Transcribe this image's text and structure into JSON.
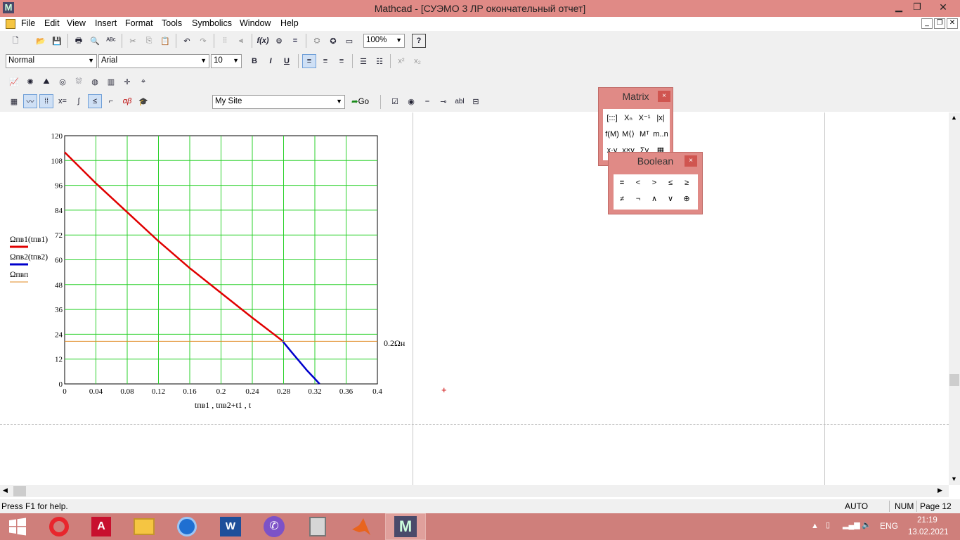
{
  "window": {
    "title": "Mathcad - [СУЭМО 3 ЛР окончательный отчет]"
  },
  "menu": [
    "File",
    "Edit",
    "View",
    "Insert",
    "Format",
    "Tools",
    "Symbolics",
    "Window",
    "Help"
  ],
  "formatting": {
    "style": "Normal",
    "font": "Arial",
    "size": "10",
    "bold": "B",
    "italic": "I",
    "underline": "U"
  },
  "standard": {
    "zoom": "100%"
  },
  "resources": {
    "site": "My Site",
    "go": "Go"
  },
  "palettes": {
    "matrix": {
      "title": "Matrix",
      "close": "×",
      "cells": [
        "[:::]",
        "Xₙ",
        "X⁻¹",
        "|x|",
        "f(M)",
        "M⟨⟩",
        "Mᵀ",
        "m..n",
        "x·y",
        "x×y",
        "Σv",
        "▦"
      ]
    },
    "boolean": {
      "title": "Boolean",
      "close": "×",
      "cells": [
        "=",
        "<",
        ">",
        "≤",
        "≥",
        "≠",
        "¬",
        "∧",
        "∨",
        "⊕"
      ]
    }
  },
  "chart_data": {
    "type": "line",
    "xlim": [
      0,
      0.4
    ],
    "ylim": [
      0,
      120
    ],
    "xticks": [
      "0",
      "0.04",
      "0.08",
      "0.12",
      "0.16",
      "0.2",
      "0.24",
      "0.28",
      "0.32",
      "0.36",
      "0.4"
    ],
    "yticks": [
      "0",
      "12",
      "24",
      "36",
      "48",
      "60",
      "72",
      "84",
      "96",
      "108",
      "120"
    ],
    "xlabel": "tпв1 , tпв2+t1 , t",
    "grid": true,
    "series": [
      {
        "name": "Ωпв1(tпв1)",
        "color": "#e00000",
        "x": [
          0,
          0.04,
          0.08,
          0.12,
          0.16,
          0.2,
          0.24,
          0.278
        ],
        "y": [
          112,
          97,
          83,
          69,
          56,
          44,
          32,
          21
        ]
      },
      {
        "name": "Ωпв2(tпв2)",
        "color": "#0000cc",
        "x": [
          0.278,
          0.29,
          0.3,
          0.31,
          0.32,
          0.326
        ],
        "y": [
          21,
          15.5,
          11,
          6.5,
          2.5,
          0
        ]
      },
      {
        "name": "Ωпвп",
        "color": "#e08a20",
        "x": [
          0,
          0.4
        ],
        "y": [
          20.6,
          20.6
        ]
      }
    ],
    "annotation": "0.2Ωн"
  },
  "statusbar": {
    "help": "Press F1 for help.",
    "auto": "AUTO",
    "num": "NUM",
    "page": "Page 12"
  },
  "taskbar": {
    "lang": "ENG",
    "time": "21:19",
    "date": "13.02.2021"
  }
}
